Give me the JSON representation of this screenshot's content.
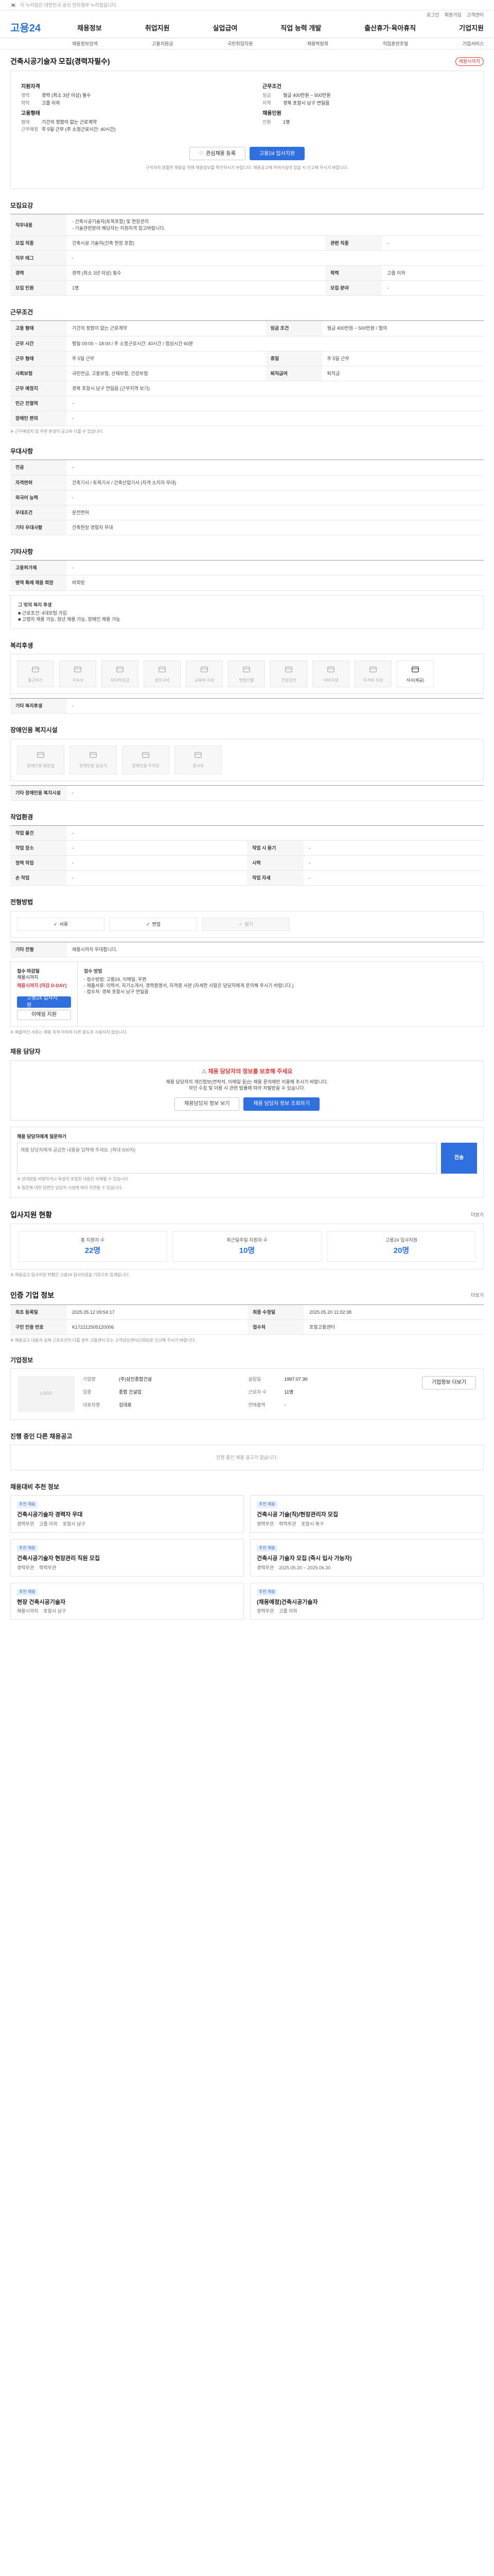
{
  "top": {
    "notice": "이 누리집은 대한민국 공식 전자정부 누리집입니다.",
    "util": [
      "로그인",
      "회원가입",
      "고객센터"
    ]
  },
  "brand": {
    "logo_a": "고용",
    "logo_b": "24"
  },
  "gnb": [
    "채용정보",
    "취업지원",
    "실업급여",
    "직업 능력 개발",
    "출산휴가·육아휴직",
    "기업지원"
  ],
  "subnav": [
    "채용정보검색",
    "고용지원금",
    "국민취업지원",
    "채용박람회",
    "직업훈련포털",
    "기업서비스"
  ],
  "job": {
    "title": "건축시공기술자 모집(경력자필수)",
    "status": "채용시까지",
    "apply_btn": "즉시지원",
    "section_company": "지원자격",
    "section_condition": "근무조건",
    "summary_left": [
      {
        "k": "경력",
        "v": "경력 (최소 3년 이상) 필수"
      },
      {
        "k": "학력",
        "v": "고졸 이하"
      }
    ],
    "summary_left_h2": "고용형태",
    "summary_left2": [
      {
        "k": "형태",
        "v": "기간의 정함이 없는 근로계약"
      },
      {
        "k": "근무예정",
        "v": "주 5일 근무 (주 소정근로시간: 40시간)"
      }
    ],
    "summary_right": [
      {
        "k": "임금",
        "v": "월급 400만원 ~ 500만원"
      },
      {
        "k": "지역",
        "v": "경북 포항시 남구 연일읍"
      }
    ],
    "summary_right_h2": "채용인원",
    "summary_right2": [
      {
        "k": "인원",
        "v": "1명"
      }
    ],
    "btn_interest": "관심채용 등록",
    "btn_apply": "고용24 입사지원",
    "notice": "구직자의 원활한 채용을 위해 채용정보를 확인하시기 바랍니다. 채용공고에 허위사실이 있을 시 신고해 주시기 바랍니다."
  },
  "recruit": {
    "h": "모집요강",
    "job_h": "직무내용",
    "job_desc": "- 건축시공기술자(토목포함) 및 현장관리\n- 기술관련분야 해당자는 지원자격 참고바랍니다.",
    "rows": [
      {
        "k": "모집 직종",
        "v": "건축시공 기술자(건축 현장 포함)",
        "k2": "관련 직종",
        "v2": "-"
      },
      {
        "k": "직무 태그",
        "v": "-"
      },
      {
        "k": "경력",
        "v": "경력 (최소 3년 이상) 필수",
        "k2": "학력",
        "v2": "고졸 이하"
      },
      {
        "k": "모집 인원",
        "v": "1명",
        "k2": "모집 분야",
        "v2": "-"
      }
    ]
  },
  "condition": {
    "h": "근무조건",
    "rows": [
      {
        "k": "고용 형태",
        "v": "기간의 정함이 없는 근로계약",
        "k2": "임금 조건",
        "v2": "월급 400만원 ~ 500만원 / 협의"
      },
      {
        "k": "근무 시간",
        "v": "평일 09:00 ~ 18:00 / 주 소정근로시간: 40시간 / 점심시간 60분"
      },
      {
        "k": "근무 형태",
        "v": "주 5일 근무",
        "k2": "휴일",
        "v2": "주 5일 근무"
      },
      {
        "k": "사회보험",
        "v": "국민연금, 고용보험, 산재보험, 건강보험",
        "k2": "퇴직급여",
        "v2": "퇴직금"
      },
      {
        "k": "근무 예정지",
        "v": "경북 포항시 남구 연일읍 (근무지역 보기)"
      },
      {
        "k": "인근 전철역",
        "v": "-"
      },
      {
        "k": "장애인 편의",
        "v": "-"
      }
    ],
    "note": "※ 근무예정지 및 주변 환경이 공고와 다를 수 있습니다."
  },
  "prefer": {
    "h": "우대사항",
    "rows": [
      {
        "k": "전공",
        "v": "-"
      },
      {
        "k": "자격면허",
        "v": "건축기사 / 토목기사 / 건축산업기사 (자격 소지자 우대)"
      },
      {
        "k": "외국어 능력",
        "v": "-"
      },
      {
        "k": "우대조건",
        "v": "운전면허"
      },
      {
        "k": "기타 우대사항",
        "v": "건축현장 경험자 우대"
      }
    ]
  },
  "etc": {
    "h": "기타사항",
    "rows": [
      {
        "k": "고용허가제",
        "v": "-"
      },
      {
        "k": "병역 특례 채용 희망",
        "v": "비희망"
      }
    ],
    "box_title": "그 밖의 복리 후생",
    "box_lines": [
      "■ 근로조건: 4대보험 가입",
      "■ 고령자 채용 가능, 청년 채용 가능, 장애인 채용 가능"
    ]
  },
  "welfare": {
    "h": "복리후생",
    "items": [
      "통근버스",
      "기숙사",
      "자녀학자금",
      "경조사비",
      "교육비 지원",
      "명절선물",
      "건강검진",
      "식비지원",
      "주거비 지원",
      "식사(제공)"
    ],
    "active_index": 9,
    "extra_label": "기타 복리후생",
    "extra_value": "-"
  },
  "disability": {
    "h": "장애인용 복지시설",
    "items": [
      "장애인용 화장실",
      "장애인용 승강기",
      "장애인용 주차장",
      "경사로"
    ],
    "extra_label": "기타 장애인용 복지시설",
    "extra_value": "-"
  },
  "env": {
    "h": "작업환경",
    "rows": [
      {
        "k": "작업 물건",
        "v": "-"
      },
      {
        "k": "작업 장소",
        "v": "-",
        "k2": "작업 시 듣기",
        "v2": "-"
      },
      {
        "k": "청력 작업",
        "v": "-",
        "k2": "시력",
        "v2": "-"
      },
      {
        "k": "손 작업",
        "v": "-",
        "k2": "작업 자세",
        "v2": "-"
      }
    ]
  },
  "method": {
    "h": "전형방법",
    "items": [
      "서류",
      "면접",
      "필기"
    ],
    "extra_label": "기타 전형",
    "extra_value": "채용시까지 우대합니다."
  },
  "apply": {
    "h": "접수 마감일",
    "deadline_label": "채용시까지",
    "deadline_red": "채용시까지 (마감 D-DAY)",
    "btn": "고용24 입사지원",
    "btn2": "이메일 지원",
    "method_h": "접수 방법",
    "method_lines": [
      "- 접수방법: 고용24, 이메일, 우편",
      "- 제출서류: 이력서, 자기소개서, 경력증명서, 자격증 사본 (자세한 사항은 담당자에게 문의해 주시기 바랍니다.)",
      "- 접수처: 경북 포항시 남구 연일읍"
    ],
    "note": "※ 제출하신 서류는 채용 목적 이외의 다른 용도로 사용되지 않습니다."
  },
  "contact": {
    "h": "채용 담당자",
    "warn_title": "채용 담당자의 정보를 보호해 주세요",
    "warn_line": "채용 담당자의 개인정보(연락처, 이메일 등)는 채용 문의에만 이용해 주시기 바랍니다.",
    "warn_line2": "무단 수집 및 이용 시 관련 법률에 따라 처벌받을 수 있습니다.",
    "btn_left": "채용담당자 정보 보기",
    "btn_right": "채용 담당자 정보 조회하기",
    "chat_label": "채용 담당자에게 질문하기",
    "chat_placeholder": "채용 담당자에게 궁금한 내용을 입력해 주세요. (최대 500자)",
    "chat_send": "전송",
    "chat_notes": [
      "※ 상대방을 비방하거나 욕설이 포함된 내용은 삭제될 수 있습니다.",
      "※ 질문에 대한 답변은 담당자 사정에 따라 지연될 수 있습니다."
    ]
  },
  "stats": {
    "h": "입사지원 현황",
    "more": "더보기",
    "items": [
      {
        "label": "총 지원자 수",
        "value": "22명"
      },
      {
        "label": "최근일주일 지원자 수",
        "value": "10명"
      },
      {
        "label": "고용24 입사지원",
        "value": "20명"
      }
    ],
    "note": "※ 채용공고 입사지원 현황은 고용24 입사지원을 기준으로 집계됩니다."
  },
  "info": {
    "h": "인증 기업 정보",
    "more": "더보기",
    "rows": [
      {
        "k": "최초 등록일",
        "v": "2025.05.12 09:54:17",
        "k2": "최종 수정일",
        "v2": "2025.05.20 11:02:38"
      },
      {
        "k": "구인 인증 번호",
        "v": "K172212505120006",
        "k2": "접수처",
        "v2": "포항고용센터"
      }
    ],
    "note": "※ 채용공고 내용과 실제 근로조건이 다를 경우 고용센터 또는 고객상담센터(1350)로 신고해 주시기 바랍니다."
  },
  "company": {
    "h": "기업정보",
    "logo_text": "LOGO",
    "grid": [
      {
        "k": "기업명",
        "v": "(주)삼진종합건설"
      },
      {
        "k": "설립일",
        "v": "1997.07.30"
      },
      {
        "k": "업종",
        "v": "종합 건설업"
      },
      {
        "k": "근로자 수",
        "v": "11명"
      },
      {
        "k": "대표자명",
        "v": "김대표"
      },
      {
        "k": "연매출액",
        "v": "-"
      }
    ],
    "btn": "기업정보 더보기"
  },
  "other": {
    "h": "진행 중인 다른 채용공고",
    "empty": "진행 중인 채용 공고가 없습니다."
  },
  "recommend": {
    "h": "채용대비 추천 정보",
    "items": [
      {
        "tag": "추천 채용",
        "title": "건축시공기술자 경력자 우대",
        "meta": [
          "경력무관",
          "고졸 이하",
          "포항시 남구"
        ]
      },
      {
        "tag": "추천 채용",
        "title": "건축시공 기술(직)/현장관리자 모집",
        "meta": [
          "경력무관",
          "학력무관",
          "포항시 북구"
        ]
      },
      {
        "tag": "추천 채용",
        "title": "건축시공기술자 현장관리 직원 모집",
        "meta": [
          "경력무관",
          "학력무관"
        ]
      },
      {
        "tag": "추천 채용",
        "title": "건축시공 기술자 모집 (즉시 입사 가능자)",
        "meta": [
          "경력무관",
          "2025.05.20 ~ 2025.06.30"
        ]
      },
      {
        "tag": "추천 채용",
        "title": "현장 건축시공기술자",
        "meta": [
          "채용시까지",
          "포항시 남구"
        ]
      },
      {
        "tag": "추천 채용",
        "title": "(채용예정)건축시공기술자",
        "meta": [
          "경력무관",
          "고졸 이하"
        ]
      }
    ]
  }
}
